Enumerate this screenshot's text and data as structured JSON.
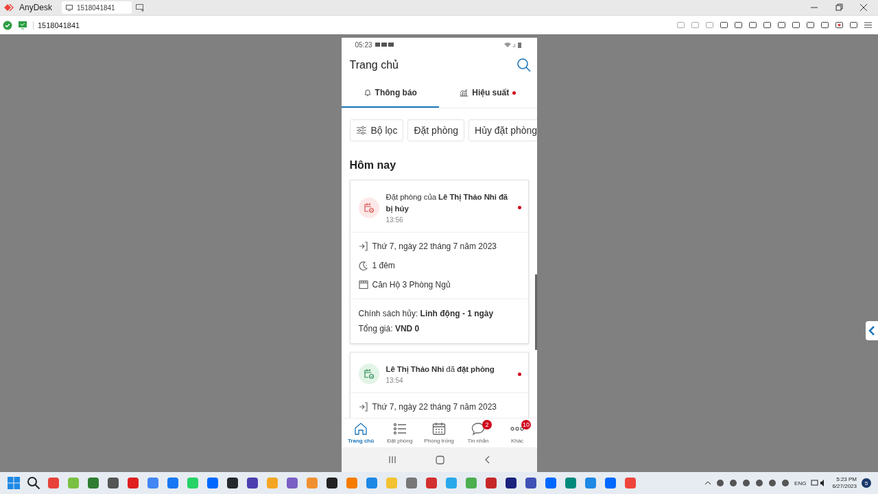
{
  "window": {
    "app_name": "AnyDesk",
    "tab_label": "1518041841"
  },
  "toolbar": {
    "address": "1518041841"
  },
  "phone": {
    "status_time": "05:23",
    "title": "Trang chủ",
    "tabs": [
      {
        "label": "Thông báo",
        "kind": "bell",
        "selected": true,
        "dot": false
      },
      {
        "label": "Hiệu suất",
        "kind": "chart",
        "selected": false,
        "dot": true
      }
    ],
    "filters": [
      {
        "label": "Bộ lọc",
        "kind": "filter"
      },
      {
        "label": "Đặt phòng",
        "kind": "chip"
      },
      {
        "label": "Hủy đặt phòng",
        "kind": "chip"
      }
    ],
    "section": "Hôm nay",
    "notifications": [
      {
        "kind": "cancelled",
        "title": "Đặt phòng của **Lê Thị Thảo Nhi đã bị hủy**",
        "time": "13:56",
        "unread": true,
        "details": [
          {
            "kind": "checkin",
            "text": "Thứ 7, ngày 22 tháng 7 năm 2023"
          },
          {
            "kind": "nights",
            "text": "1 đêm"
          },
          {
            "kind": "room",
            "text": "Căn Hộ 3 Phòng Ngủ"
          }
        ],
        "footer": [
          "Chính sách hủy: **Linh động - 1 ngày**",
          "Tổng giá: **VND 0**"
        ]
      },
      {
        "kind": "booked",
        "title": "**Lê Thị Thảo Nhi** đã **đặt phòng**",
        "time": "13:54",
        "unread": true,
        "details": [
          {
            "kind": "checkin",
            "text": "Thứ 7, ngày 22 tháng 7 năm 2023"
          }
        ]
      }
    ],
    "bottom_nav": [
      {
        "label": "Trang chủ",
        "kind": "home",
        "selected": true
      },
      {
        "label": "Đặt phòng",
        "kind": "list",
        "selected": false
      },
      {
        "label": "Phòng trống",
        "kind": "calendar",
        "selected": false
      },
      {
        "label": "Tin nhắn",
        "kind": "chat",
        "selected": false,
        "badge": "2"
      },
      {
        "label": "Khác",
        "kind": "more",
        "selected": false,
        "badge": "10"
      }
    ]
  },
  "taskbar": {
    "language": "ENG",
    "time": "5:23 PM",
    "date": "6/27/2023",
    "notification_count": "5"
  }
}
